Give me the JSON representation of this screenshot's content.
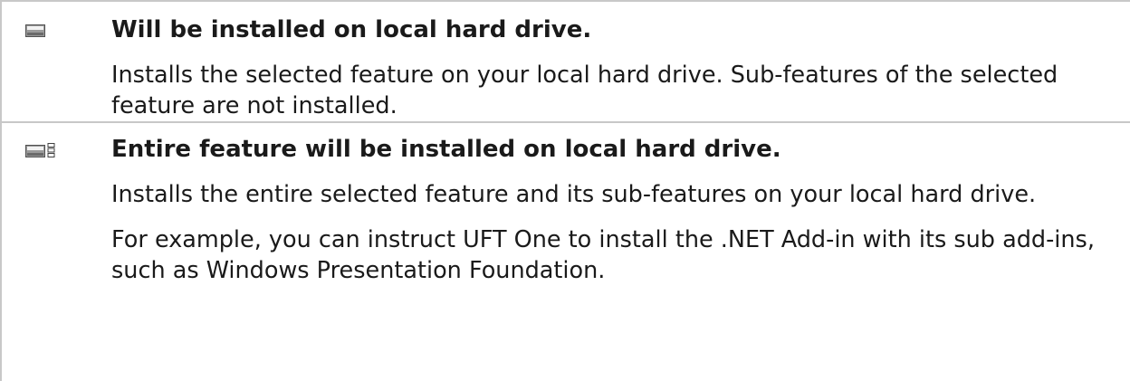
{
  "rows": [
    {
      "icon": "hard-drive-icon",
      "term": "Will be installed on local hard drive.",
      "paragraphs": [
        "Installs the selected feature on your local hard drive. Sub-features of the selected feature are not installed."
      ]
    },
    {
      "icon": "hard-drive-entire-feature-icon",
      "term": "Entire feature will be installed on local hard drive.",
      "paragraphs": [
        "Installs the entire selected feature and its sub-features on your local hard drive.",
        "For example, you can instruct UFT One to install the .NET Add-in with its sub add-ins, such as Windows Presentation Foundation."
      ]
    }
  ]
}
